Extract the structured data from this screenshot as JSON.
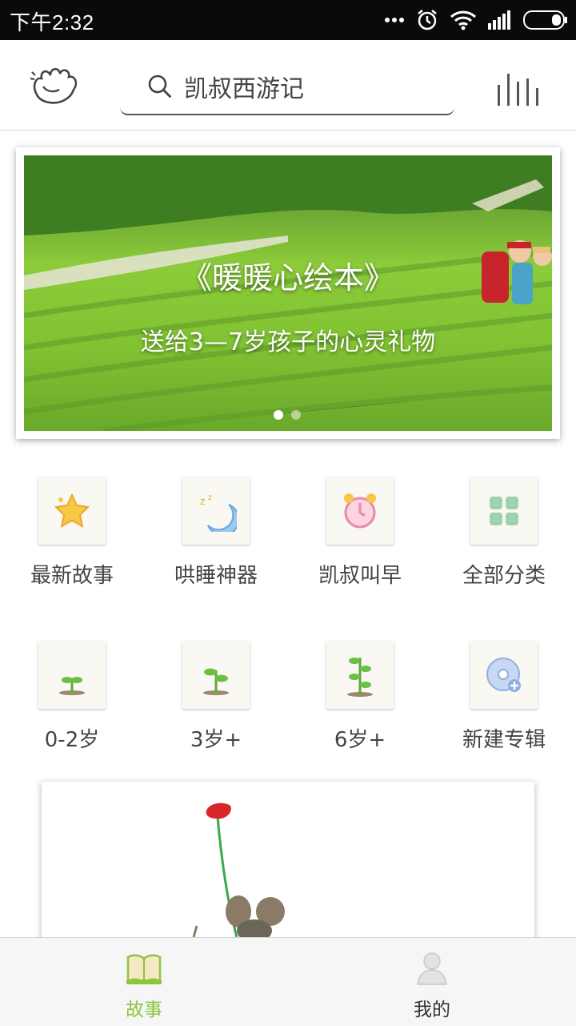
{
  "status_bar": {
    "time": "下午2:32",
    "icons": [
      "more-dots-icon",
      "alarm-icon",
      "wifi-icon",
      "signal-icon",
      "battery-icon"
    ]
  },
  "header": {
    "logo_icon": "hand-logo-icon",
    "search_text": "凯叔西游记",
    "search_icon": "search-icon",
    "bars_icon": "audio-bars-icon"
  },
  "banner": {
    "title": "《暖暖心绘本》",
    "subtitle": "送给3—7岁孩子的心灵礼物",
    "page_count": 2,
    "active_page": 1
  },
  "categories": [
    {
      "label": "最新故事",
      "icon": "star-icon"
    },
    {
      "label": "哄睡神器",
      "icon": "moon-icon"
    },
    {
      "label": "凯叔叫早",
      "icon": "alarm-clock-icon"
    },
    {
      "label": "全部分类",
      "icon": "grid-icon"
    },
    {
      "label": "0-2岁",
      "icon": "sprout-small-icon"
    },
    {
      "label": "3岁+",
      "icon": "sprout-medium-icon"
    },
    {
      "label": "6岁+",
      "icon": "sprout-large-icon"
    },
    {
      "label": "新建专辑",
      "icon": "new-album-disc-icon"
    }
  ],
  "bottom_nav": [
    {
      "label": "故事",
      "icon": "book-icon",
      "active": true
    },
    {
      "label": "我的",
      "icon": "person-icon",
      "active": false
    }
  ],
  "colors": {
    "active_green": "#8cc63f",
    "inactive_text": "#333333",
    "status_bar": "#0a0a0a"
  }
}
